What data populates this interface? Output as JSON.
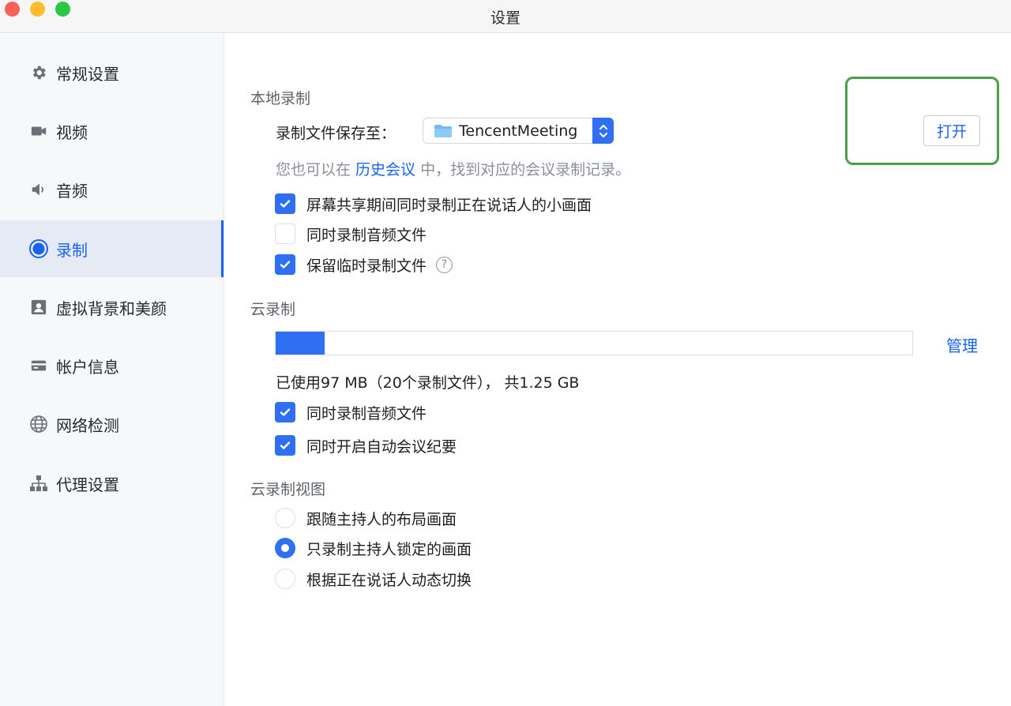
{
  "window": {
    "title": "设置"
  },
  "sidebar": {
    "items": [
      {
        "label": "常规设置",
        "icon": "gear-icon"
      },
      {
        "label": "视频",
        "icon": "video-camera-icon"
      },
      {
        "label": "音频",
        "icon": "speaker-icon"
      },
      {
        "label": "录制",
        "icon": "record-icon",
        "active": true
      },
      {
        "label": "虚拟背景和美颜",
        "icon": "portrait-icon"
      },
      {
        "label": "帐户信息",
        "icon": "card-icon"
      },
      {
        "label": "网络检测",
        "icon": "globe-icon"
      },
      {
        "label": "代理设置",
        "icon": "network-tree-icon"
      }
    ]
  },
  "local_recording": {
    "title": "本地录制",
    "save_label": "录制文件保存至：",
    "save_path": "TencentMeeting",
    "open_button": "打开",
    "hint_before": "您也可以在 ",
    "hint_link": "历史会议",
    "hint_after": " 中，找到对应的会议录制记录。",
    "options": [
      {
        "label": "屏幕共享期间同时录制正在说话人的小画面",
        "checked": true
      },
      {
        "label": "同时录制音频文件",
        "checked": false
      },
      {
        "label": "保留临时录制文件",
        "checked": true,
        "help": "?"
      }
    ]
  },
  "cloud_recording": {
    "title": "云录制",
    "manage_link": "管理",
    "usage_fraction": 0.077,
    "usage_text": "已使用97 MB（20个录制文件），  共1.25 GB",
    "options": [
      {
        "label": "同时录制音频文件",
        "checked": true
      },
      {
        "label": "同时开启自动会议纪要",
        "checked": true
      }
    ]
  },
  "cloud_view": {
    "title": "云录制视图",
    "options": [
      {
        "label": "跟随主持人的布局画面",
        "selected": false
      },
      {
        "label": "只录制主持人锁定的画面",
        "selected": true
      },
      {
        "label": "根据正在说话人动态切换",
        "selected": false
      }
    ]
  },
  "colors": {
    "accent": "#2f6ff2",
    "highlight": "#4aa04a"
  }
}
